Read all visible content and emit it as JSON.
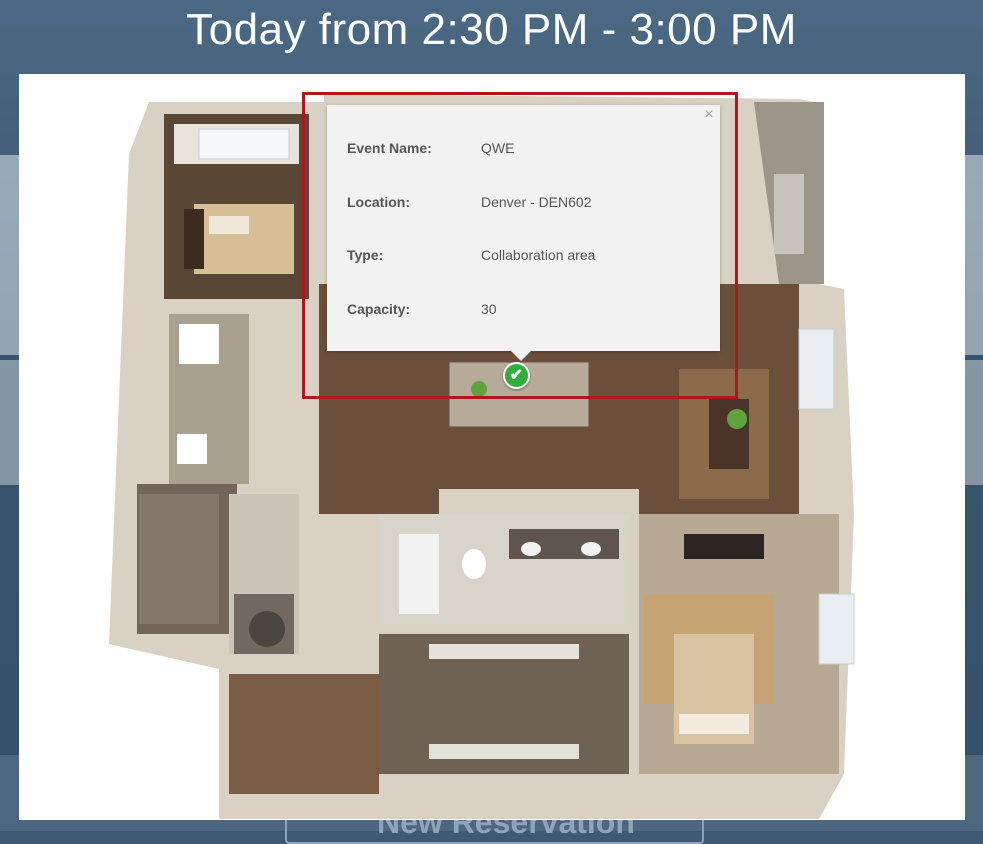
{
  "header": {
    "title": "Today from 2:30 PM - 3:00 PM"
  },
  "popup": {
    "close_label": "×",
    "fields": [
      {
        "label": "Event Name:",
        "value": "QWE"
      },
      {
        "label": "Location:",
        "value": "Denver - DEN602"
      },
      {
        "label": "Type:",
        "value": "Collaboration area"
      },
      {
        "label": "Capacity:",
        "value": "30"
      }
    ]
  },
  "marker": {
    "icon": "check-circle-icon",
    "glyph": "✔",
    "color": "#2fae3a"
  },
  "background": {
    "button_label": "New Reservation"
  },
  "colors": {
    "highlight": "#b0161b",
    "header_bg": "#3e5a72"
  }
}
